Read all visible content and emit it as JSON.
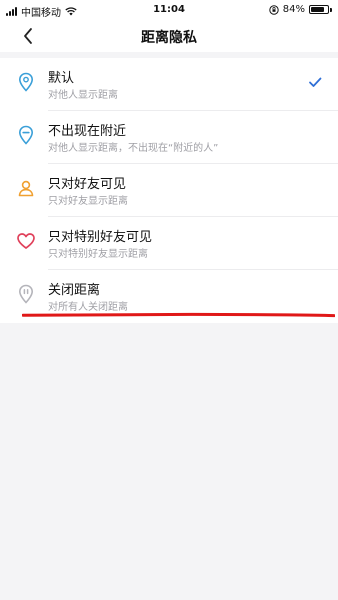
{
  "status_bar": {
    "carrier": "中国移动",
    "time": "11:04",
    "battery_text": "84%",
    "battery_level": 0.84
  },
  "nav": {
    "title": "距离隐私"
  },
  "options": [
    {
      "title": "默认",
      "subtitle": "对他人显示距离",
      "icon": "location-pin-icon",
      "color": "#3a9fd8",
      "selected": true
    },
    {
      "title": "不出现在附近",
      "subtitle": "对他人显示距离，不出现在“附近的人”",
      "icon": "location-pin-minus-icon",
      "color": "#3a9fd8",
      "selected": false
    },
    {
      "title": "只对好友可见",
      "subtitle": "只对好友显示距离",
      "icon": "person-icon",
      "color": "#f0a030",
      "selected": false
    },
    {
      "title": "只对特别好友可见",
      "subtitle": "只对特别好友显示距离",
      "icon": "heart-icon",
      "color": "#e0405a",
      "selected": false
    },
    {
      "title": "关闭距离",
      "subtitle": "对所有人关闭距离",
      "icon": "location-pin-off-icon",
      "color": "#b4b4ba",
      "selected": false
    }
  ],
  "colors": {
    "check": "#2f6fd6",
    "annotation": "#e01818"
  }
}
